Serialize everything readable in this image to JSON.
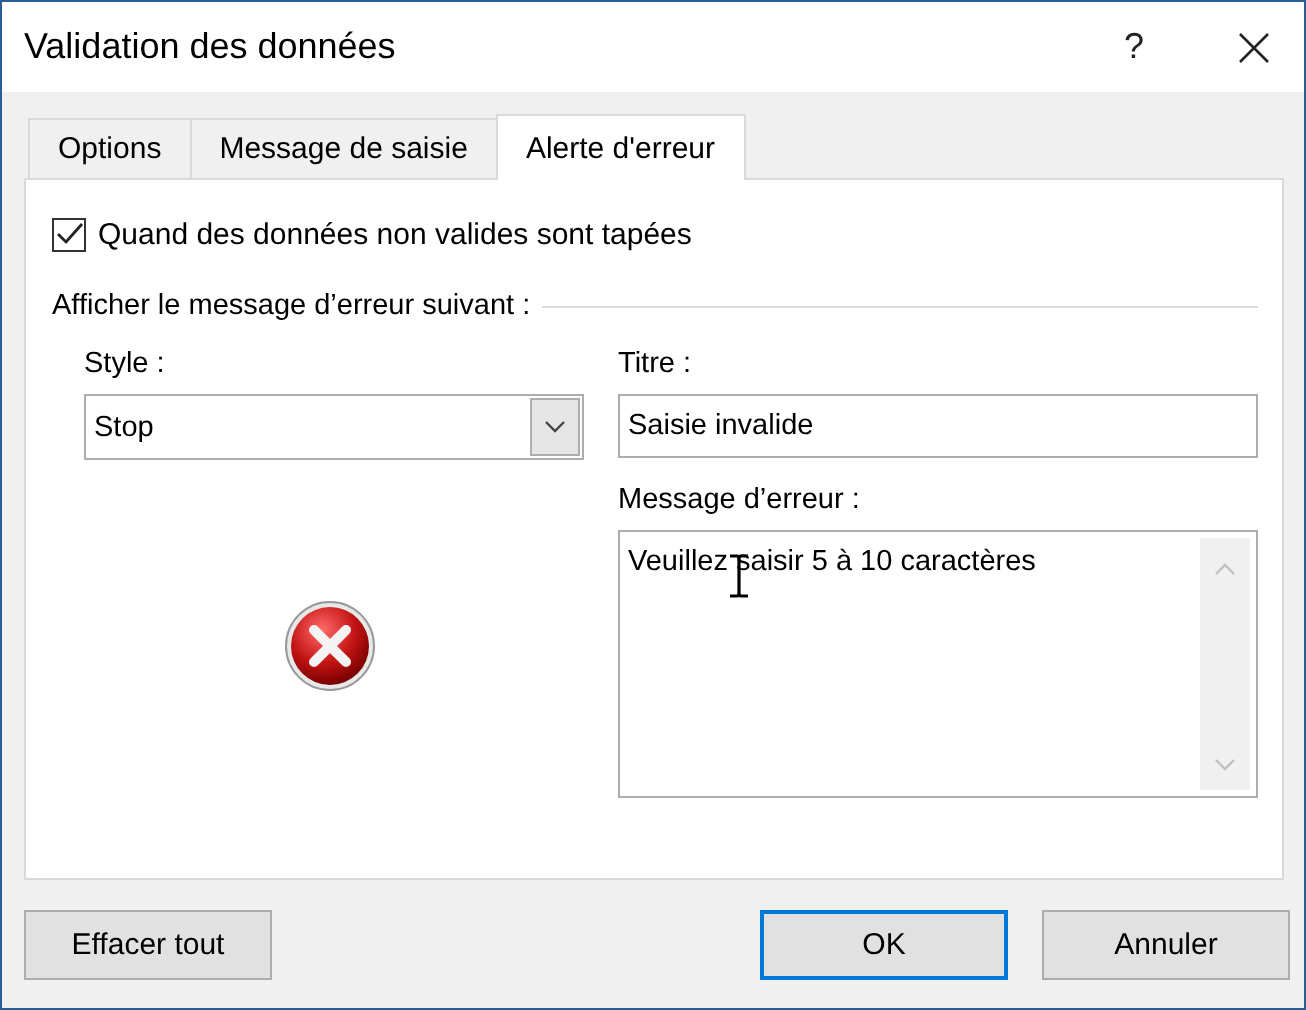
{
  "window": {
    "title": "Validation des données",
    "help": "?"
  },
  "tabs": [
    {
      "label": "Options",
      "selected": false
    },
    {
      "label": "Message de saisie",
      "selected": false
    },
    {
      "label": "Alerte d'erreur",
      "selected": true
    }
  ],
  "checkbox": {
    "label": "Quand des données non valides sont tapées",
    "checked": true
  },
  "group_label": "Afficher le message d’erreur suivant :",
  "style": {
    "label": "Style :",
    "value": "Stop",
    "kind": "stop"
  },
  "title_field": {
    "label": "Titre :",
    "value": "Saisie invalide"
  },
  "message_field": {
    "label": "Message d’erreur :",
    "value": "Veuillez saisir 5 à 10 caractères"
  },
  "buttons": [
    {
      "label": "Effacer tout",
      "kind": "left",
      "default": false
    },
    {
      "label": "OK",
      "kind": "right",
      "default": true
    },
    {
      "label": "Annuler",
      "kind": "right",
      "default": false
    }
  ]
}
